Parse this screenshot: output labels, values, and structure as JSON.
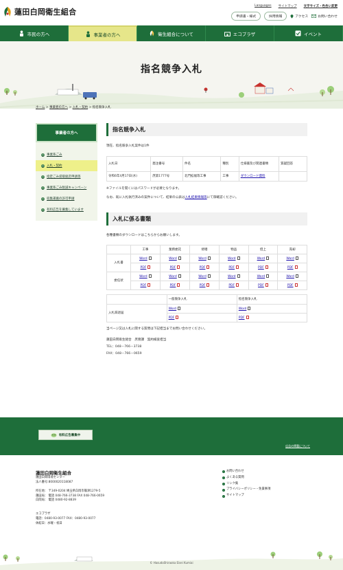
{
  "header": {
    "logo_text": "蓮田白岡衛生組合",
    "top_links": [
      "Languages",
      "サイトマップ"
    ],
    "font_size_label": "文字サイズ・色合い変更",
    "buttons": [
      "申請書・様式",
      "採用情報"
    ],
    "access": "アクセス",
    "contact": "お問い合わせ"
  },
  "nav": {
    "items": [
      "市民の方へ",
      "事業者の方へ",
      "衛生組合について",
      "エコプラザ",
      "イベント"
    ],
    "active_index": 1
  },
  "hero": {
    "title": "指名競争入札"
  },
  "breadcrumb": [
    "ホーム",
    "事業者の方へ",
    "入札・契約",
    "指名競争入札"
  ],
  "sidebar": {
    "title": "事業者の方へ",
    "items": [
      "事業系ごみ",
      "入札・契約",
      "指定ごみ袋取扱店申請等",
      "事業系ごみ削減キャンペーン",
      "収集運搬の許可申請",
      "有料広告を募集しています"
    ],
    "active_index": 1
  },
  "main": {
    "heading1": "指名競争入札",
    "count_text": "現在、指名競争入札案件は1件",
    "table1": {
      "headers": [
        "入札日",
        "発注番号",
        "件名",
        "種別",
        "仕様書及び関連書類",
        "質疑回答"
      ],
      "row": [
        "令和6年4月17日(水)",
        "庶第1777号",
        "北門拡幅等工事",
        "工事",
        "ダウンロード資料",
        ""
      ]
    },
    "note1": "※ファイルを開くにはパスワードが必要となります。",
    "note2_pre": "なお、既に入札執行済みの案件について、結果の公表は",
    "note2_link": "入札結果情報等",
    "note2_post": "にて御確認ください。",
    "heading2": "入札に係る書類",
    "download_text": "各種書類のダウンロードはこちらからお願いします。",
    "table2": {
      "headers": [
        "工事",
        "業務委託",
        "修繕",
        "物品",
        "借上",
        "売却"
      ],
      "row_labels": [
        "入札書",
        "委任状"
      ],
      "word_label": "Word",
      "pdf_label": "PDF"
    },
    "table3": {
      "headers": [
        "一般競争入札",
        "指名競争入札"
      ],
      "row_label": "入札辞退届",
      "word_label": "Word",
      "pdf_label": "PDF"
    },
    "contact_text": "当ページ又は入札に関する質問は下記担当までお問い合わせください。",
    "contact_dept": "蓮田白岡衛生組合　庶務課　契約検査担当",
    "tel": "TEL：048－766－3738",
    "fax": "FAX：048－766－0659"
  },
  "band": {
    "banner_label": "有料広告募集中",
    "link": "広告の掲載について"
  },
  "footer": {
    "title": "蓮田白岡衛生組合",
    "lines": [
      "蓮田白岡環境センター",
      "法人番号:8000020118087",
      "",
      "所在地： 〒349-0204 埼玉県白岡市篠津1279-5",
      "蓮田局： 電話 048-766-3738 FAX 048-766-0659",
      "白岡局： 電話 0480-92-8839",
      "",
      "",
      "エコプラザ",
      "電話：0480-93-0077 FAX：0480-93-0077",
      "休館日：水曜・祝日"
    ],
    "links": [
      "お問い合わせ",
      "よくある質問",
      "リンク集",
      "プライバシーポリシー・免責事項",
      "サイトマップ"
    ],
    "copyright": "© HasudaShiraoka Eisei Kumiai"
  },
  "colors": {
    "brand": "#1e6e3a",
    "accent": "#e6e68a"
  }
}
